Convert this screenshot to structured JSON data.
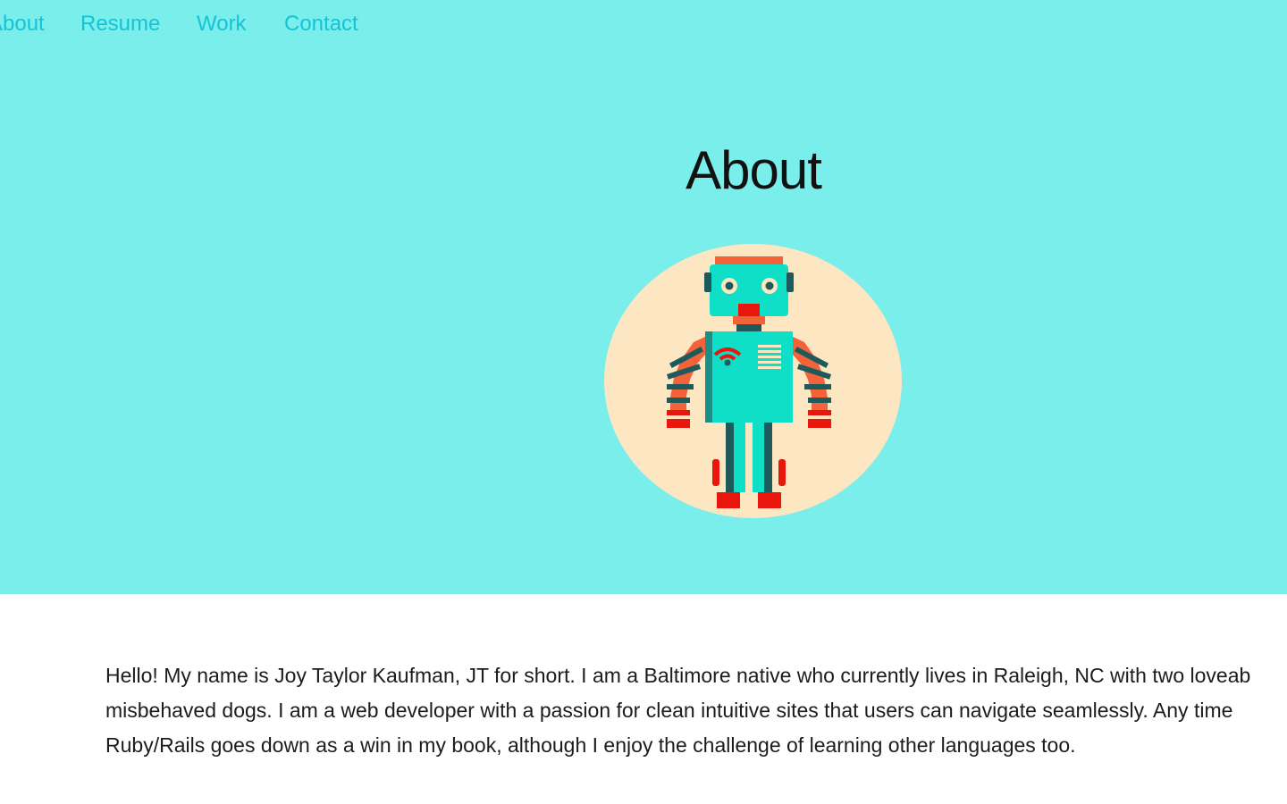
{
  "nav": {
    "items": [
      {
        "label": "About"
      },
      {
        "label": "Resume"
      },
      {
        "label": "Work"
      },
      {
        "label": "Contact"
      }
    ]
  },
  "hero": {
    "title": "About",
    "avatar_icon": "robot-icon"
  },
  "bio": {
    "lines": [
      "Hello! My name is Joy Taylor Kaufman, JT for short. I am a Baltimore native who currently lives in Raleigh, NC with two loveab",
      "misbehaved dogs. I am a web developer with a passion for clean intuitive sites that users can navigate seamlessly. Any time",
      "Ruby/Rails goes down as a win in my book, although I enjoy the challenge of learning other languages too."
    ]
  },
  "colors": {
    "hero_background": "#7AEEEA",
    "nav_link": "#14C3D8",
    "avatar_background": "#FDE6C2",
    "robot_body": "#10DFC8",
    "robot_accent": "#F4623A",
    "robot_dark": "#1E5A5C"
  }
}
